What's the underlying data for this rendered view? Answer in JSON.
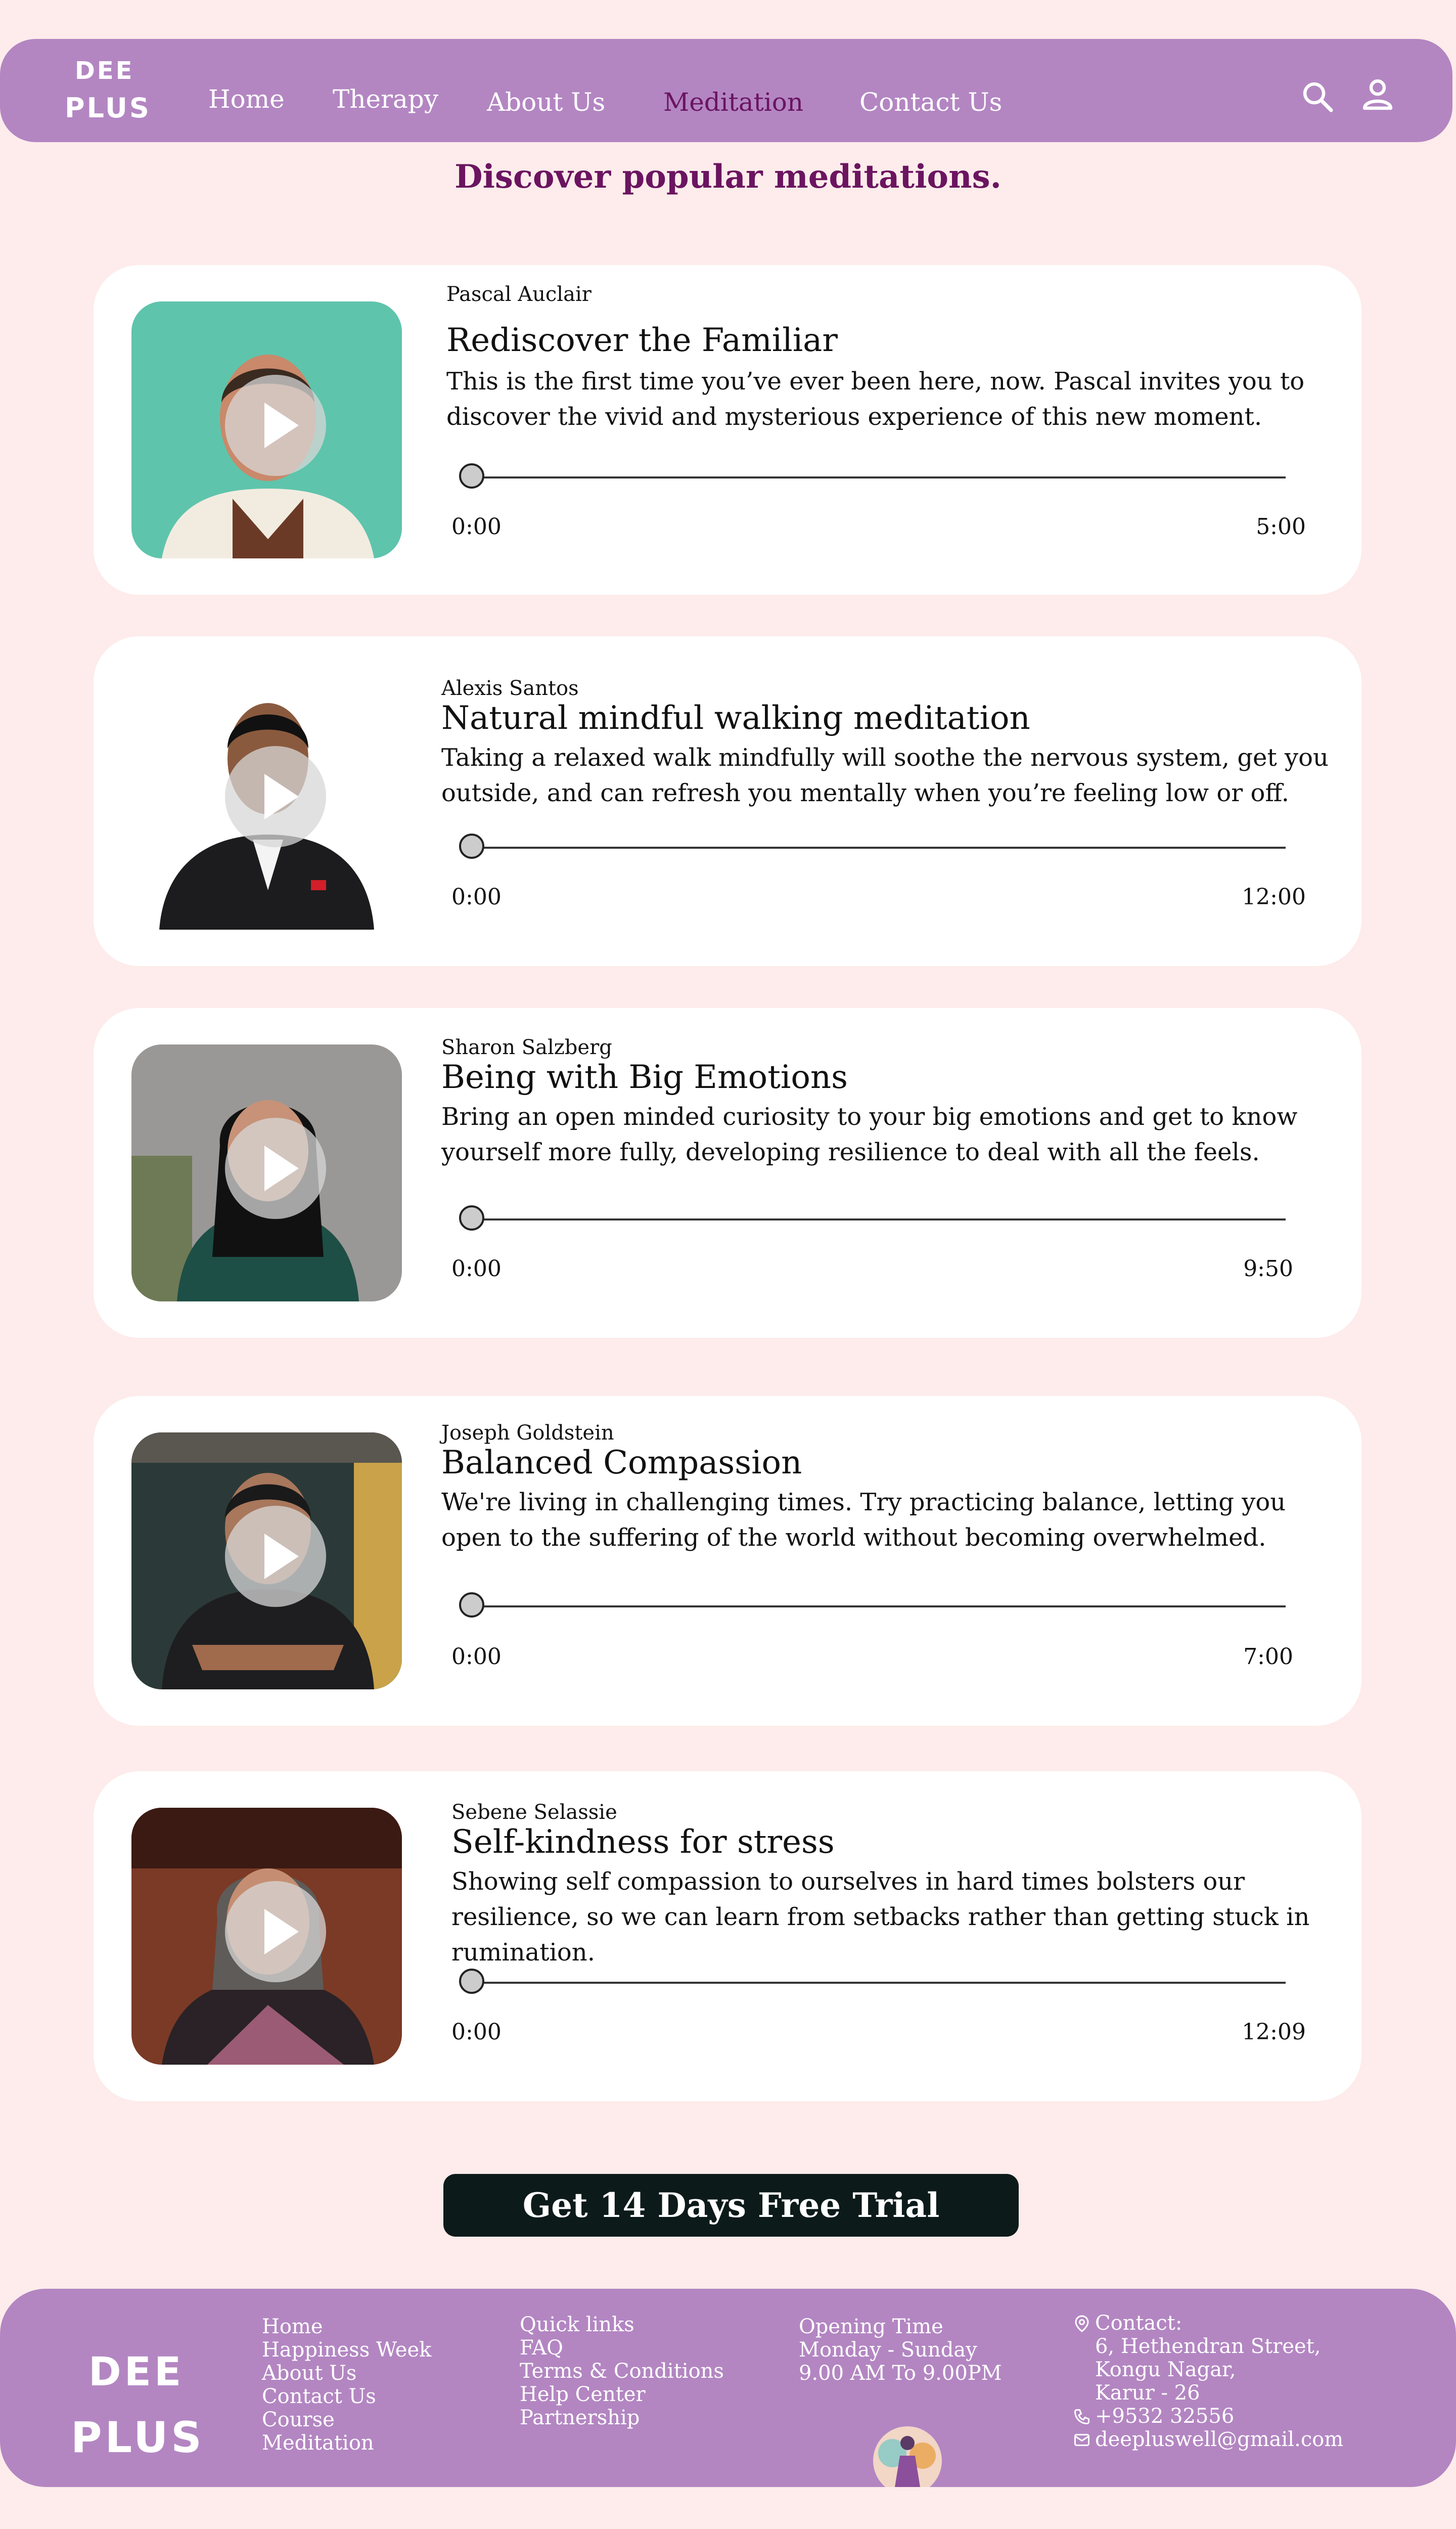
{
  "nav": {
    "logo_top": "DEE",
    "logo_bottom": "PLUS",
    "links": [
      "Home",
      "Therapy",
      "About Us",
      "Meditation",
      "Contact Us"
    ],
    "active": "Meditation",
    "icons": [
      "search-icon",
      "user-icon"
    ]
  },
  "heading": "Discover popular meditations.",
  "tracks": [
    {
      "author": "Pascal Auclair",
      "title": "Rediscover the Familiar",
      "description": "This is the first time you’ve ever been here, now. Pascal invites you to discover the vivid and mysterious experience of this new moment.",
      "current": "0:00",
      "duration": "5:00",
      "progress": 0
    },
    {
      "author": "Alexis Santos",
      "title": "Natural mindful walking meditation",
      "description": "Taking a relaxed walk mindfully will soothe the nervous system, get you outside, and can refresh you mentally when you’re feeling low or off.",
      "current": "0:00",
      "duration": "12:00",
      "progress": 0
    },
    {
      "author": "Sharon Salzberg",
      "title": "Being with Big Emotions",
      "description": "Bring an open minded curiosity to your big emotions and get to know yourself more fully, developing resilience to deal with all the feels.",
      "current": "0:00",
      "duration": "9:50",
      "progress": 0
    },
    {
      "author": "Joseph Goldstein",
      "title": "Balanced Compassion",
      "description": "We're living in challenging times. Try practicing balance, letting you open to the suffering of the world without becoming overwhelmed.",
      "current": "0:00",
      "duration": "7:00",
      "progress": 0
    },
    {
      "author": "Sebene Selassie",
      "title": "Self-kindness for stress",
      "description": "Showing self compassion to ourselves in hard times bolsters our resilience, so we can learn from setbacks rather than getting stuck in rumination.",
      "current": "0:00",
      "duration": "12:09",
      "progress": 0
    }
  ],
  "cta": "Get 14 Days Free Trial",
  "footer": {
    "logo_top": "DEE",
    "logo_bottom": "PLUS",
    "nav_links": [
      "Home",
      "Happiness Week",
      "About Us",
      "Contact Us",
      "Course",
      "Meditation"
    ],
    "quick_links": [
      "Quick links",
      "FAQ",
      "Terms & Conditions",
      "Help Center",
      "Partnership"
    ],
    "opening": [
      "Opening Time",
      "Monday - Sunday",
      "9.00 AM To 9.00PM"
    ],
    "contact_label": "Contact:",
    "address": [
      "6, Hethendran Street,",
      "Kongu Nagar,",
      "Karur - 26"
    ],
    "phone": "+9532 32556",
    "email": "deepluswell@gmail.com"
  },
  "colors": {
    "background": "#fdeceb",
    "nav": "#b386c2",
    "accent": "#6b1460",
    "cta": "#0d1a1a"
  }
}
